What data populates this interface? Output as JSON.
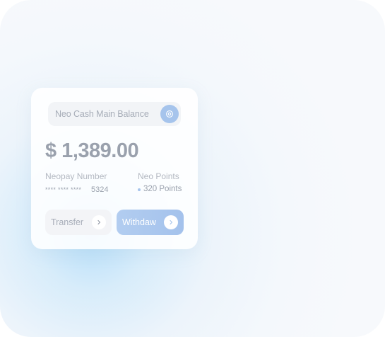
{
  "card": {
    "balance_label": "Neo Cash Main Balance",
    "amount": "$ 1,389.00",
    "neopay_label": "Neopay Number",
    "neopay_masked": "**** **** ****",
    "neopay_last4": "5324",
    "points_label": "Neo Points",
    "points_value": "320 Points"
  },
  "actions": {
    "transfer_label": "Transfer",
    "withdraw_label": "Withdaw"
  },
  "icons": {
    "toggle": "eye-icon",
    "chevron": "chevron-right-icon"
  },
  "colors": {
    "accent": "#a6c4ec",
    "text_primary": "#9aa1ad",
    "text_muted": "#b3b8c1",
    "glow": "#b2dcf8"
  }
}
